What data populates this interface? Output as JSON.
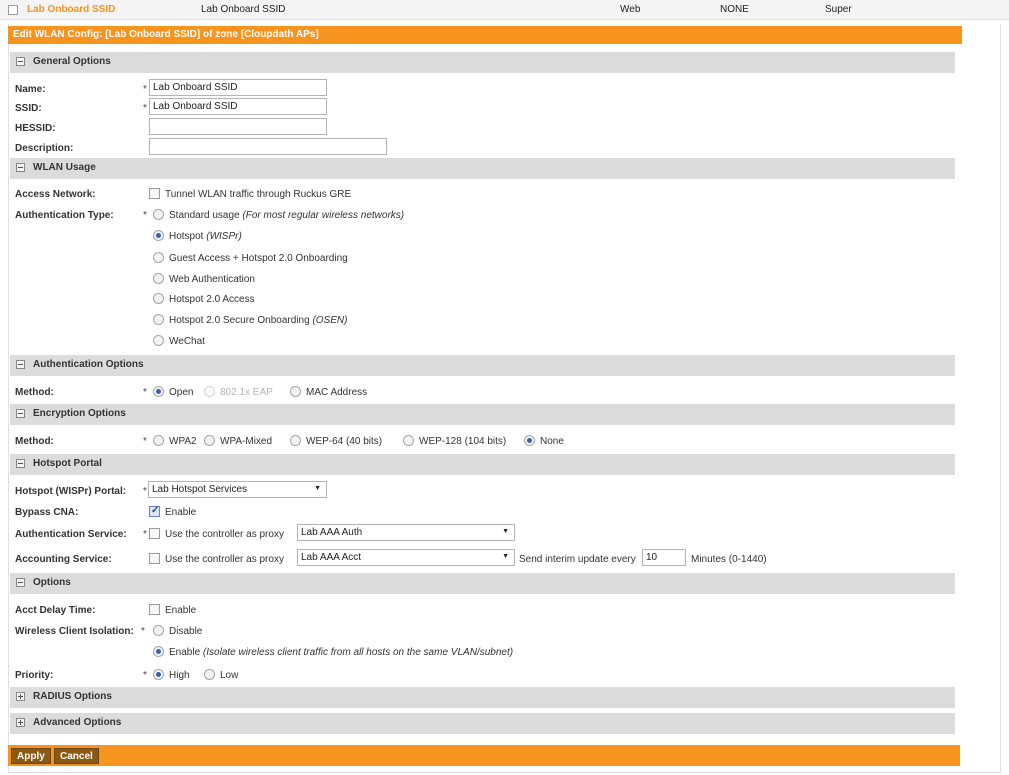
{
  "list_row": {
    "name": "Lab Onboard SSID",
    "ssid": "Lab Onboard SSID",
    "auth": "Web",
    "encryption": "NONE",
    "creator": "Super"
  },
  "form_title": "Edit WLAN Config: [Lab Onboard SSID] of zone [Cloupdath APs]",
  "sections": {
    "general": "General Options",
    "usage": "WLAN Usage",
    "auth": "Authentication Options",
    "encryption": "Encryption Options",
    "hotspot": "Hotspot Portal",
    "options": "Options",
    "radius": "RADIUS Options",
    "advanced": "Advanced Options"
  },
  "general": {
    "name_label": "Name:",
    "name_value": "Lab Onboard SSID",
    "ssid_label": "SSID:",
    "ssid_value": "Lab Onboard SSID",
    "hessid_label": "HESSID:",
    "hessid_value": "",
    "description_label": "Description:",
    "description_value": ""
  },
  "usage": {
    "access_network_label": "Access Network:",
    "tunnel_label": "Tunnel WLAN traffic through Ruckus GRE",
    "auth_type_label": "Authentication Type:",
    "standard": "Standard usage",
    "standard_hint": "(For most regular wireless networks)",
    "hotspot": "Hotspot",
    "hotspot_hint": "(WISPr)",
    "guest": "Guest Access + Hotspot 2.0 Onboarding",
    "web_auth": "Web Authentication",
    "hs20": "Hotspot 2.0 Access",
    "hs20_secure": "Hotspot 2.0 Secure Onboarding",
    "hs20_secure_hint": "(OSEN)",
    "wechat": "WeChat"
  },
  "auth_options": {
    "method_label": "Method:",
    "open": "Open",
    "eap": "802.1x EAP",
    "mac": "MAC Address"
  },
  "encryption": {
    "method_label": "Method:",
    "wpa2": "WPA2",
    "wpa_mixed": "WPA-Mixed",
    "wep64": "WEP-64 (40 bits)",
    "wep128": "WEP-128 (104 bits)",
    "none": "None"
  },
  "hotspot": {
    "portal_label": "Hotspot (WISPr) Portal:",
    "portal_value": "Lab Hotspot Services",
    "bypass_label": "Bypass CNA:",
    "bypass_enable": "Enable",
    "auth_service_label": "Authentication Service:",
    "auth_proxy": "Use the controller as proxy",
    "auth_service_value": "Lab AAA Auth",
    "acct_service_label": "Accounting Service:",
    "acct_proxy": "Use the controller as proxy",
    "acct_service_value": "Lab AAA Acct",
    "interim_label": "Send interim update every",
    "interim_value": "10",
    "interim_unit": "Minutes (0-1440)"
  },
  "options": {
    "acct_delay_label": "Acct Delay Time:",
    "acct_delay_enable": "Enable",
    "isolation_label": "Wireless Client Isolation:",
    "isolation_disable": "Disable",
    "isolation_enable": "Enable",
    "isolation_hint": "(Isolate wireless client traffic from all hosts on the same VLAN/subnet)",
    "priority_label": "Priority:",
    "high": "High",
    "low": "Low"
  },
  "buttons": {
    "apply": "Apply",
    "cancel": "Cancel"
  },
  "required_mark": "*",
  "colors": {
    "accent": "#f7941d",
    "section_bg": "#dcdcdc",
    "button_bg": "#8a5a12",
    "radio_selected": "#3a5fa8"
  }
}
